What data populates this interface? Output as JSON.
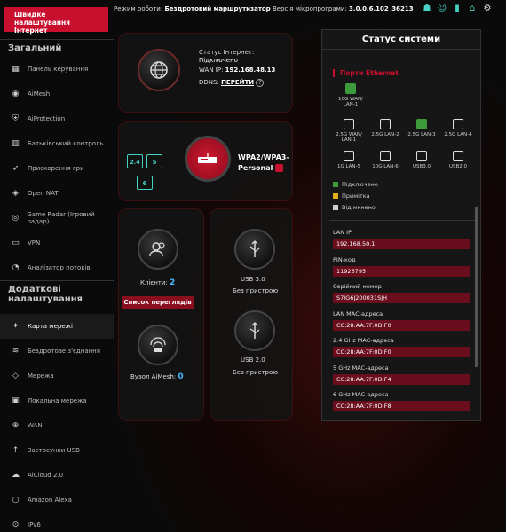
{
  "top": {
    "quick_label": "Швидке налаштування Інтернет",
    "mode_label": "Режим роботи:",
    "mode_value": "Бездротовий маршрутизатор",
    "firmware_label": "Версія мікропрограми:",
    "firmware_value": "3.0.0.6.102_36213"
  },
  "sidebar": {
    "general_title": "Загальний",
    "general": [
      {
        "label": "Панель керування",
        "icon": "dashboard-icon"
      },
      {
        "label": "AiMesh",
        "icon": "mesh-icon"
      },
      {
        "label": "AiProtection",
        "icon": "shield-icon"
      },
      {
        "label": "Батьківський контроль",
        "icon": "parental-icon"
      },
      {
        "label": "Прискорення гри",
        "icon": "rocket-icon"
      },
      {
        "label": "Open NAT",
        "icon": "game-icon"
      },
      {
        "label": "Game Radar (Ігровий радар)",
        "icon": "radar-icon"
      },
      {
        "label": "VPN",
        "icon": "vpn-icon"
      },
      {
        "label": "Аналізатор потоків",
        "icon": "analyzer-icon"
      }
    ],
    "advanced_title": "Додаткові налаштування",
    "advanced": [
      {
        "label": "Карта мережі",
        "icon": "map-icon",
        "active": true
      },
      {
        "label": "Бездротове з'єднання",
        "icon": "wireless-icon"
      },
      {
        "label": "Мережа",
        "icon": "network-icon"
      },
      {
        "label": "Локальна мережа",
        "icon": "lan-icon"
      },
      {
        "label": "WAN",
        "icon": "globe-icon"
      },
      {
        "label": "Застосунки USB",
        "icon": "usb-icon"
      },
      {
        "label": "AiCloud 2.0",
        "icon": "cloud-icon"
      },
      {
        "label": "Amazon Alexa",
        "icon": "alexa-icon"
      },
      {
        "label": "IPv6",
        "icon": "ipv6-icon"
      }
    ]
  },
  "internet": {
    "status_label": "Статус Інтернет:",
    "status_value": "Підключено",
    "wan_label": "WAN IP:",
    "wan_value": "192.168.48.13",
    "ddns_label": "DDNS:",
    "ddns_link": "ПЕРЕЙТИ"
  },
  "wireless": {
    "security": "WPA2/WPA3-Personal",
    "bands": [
      "2.4",
      "5",
      "6"
    ]
  },
  "clients": {
    "label": "Клієнти:",
    "count": "2",
    "view_list": "Список переглядів"
  },
  "aimesh": {
    "label": "Вузол AiMesh:",
    "count": "0"
  },
  "usb": [
    {
      "name": "USB 3.0",
      "status": "Без пристрою"
    },
    {
      "name": "USB 2.0",
      "status": "Без пристрою"
    }
  ],
  "system_status": {
    "title": "Статус системи",
    "ports_title": "Порти Ethernet",
    "wan_port": {
      "label": "10G WAN/ LAN-1"
    },
    "ports_row1": [
      {
        "label": "2.5G WAN/ LAN-1",
        "on": false
      },
      {
        "label": "2.5G LAN-2",
        "on": false
      },
      {
        "label": "2.5G LAN-3",
        "on": true
      },
      {
        "label": "2.5G LAN-4",
        "on": false
      }
    ],
    "ports_row2": [
      {
        "label": "1G LAN-5"
      },
      {
        "label": "10G LAN-6"
      },
      {
        "label": "USB3.0"
      },
      {
        "label": "USB2.0"
      }
    ],
    "legend": [
      {
        "label": "Підключено",
        "color": "#3c9c3c"
      },
      {
        "label": "Примітка",
        "color": "#e0b020"
      },
      {
        "label": "Відімкнено",
        "color": "#cccccc"
      }
    ],
    "fields": [
      {
        "label": "LAN IP",
        "value": "192.168.50.1"
      },
      {
        "label": "PIN-код",
        "value": "11926795"
      },
      {
        "label": "Серійний номер",
        "value": "S7IG6J200031SJH"
      },
      {
        "label": "LAN MAC-адреса",
        "value": "CC:28:AA:7F:0D:F0"
      },
      {
        "label": "2.4 GHz MAC-адреса",
        "value": "CC:28:AA:7F:0D:F0"
      },
      {
        "label": "5 GHz MAC-адреса",
        "value": "CC:28:AA:7F:0D:F4"
      },
      {
        "label": "6 GHz MAC-адреса",
        "value": "CC:28:AA:7F:0D:F8"
      }
    ]
  }
}
